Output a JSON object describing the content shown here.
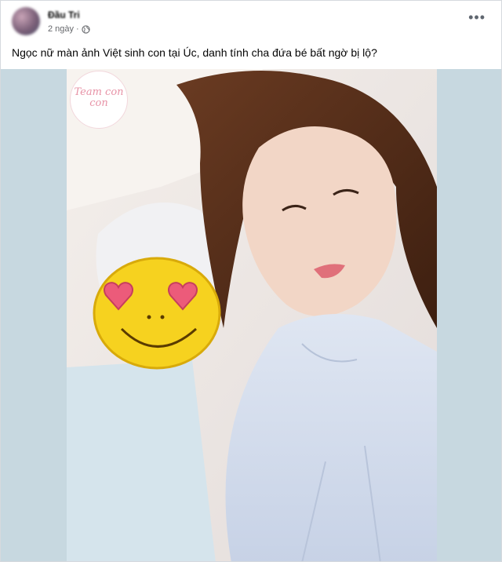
{
  "post": {
    "author": "Đầu Tri",
    "time": "2 ngày",
    "privacy_icon": "globe-icon",
    "more_label": "•••",
    "caption": "Ngọc nữ màn ảnh Việt sinh con tại Úc, danh tính cha đứa bé bất ngờ bị lộ?"
  },
  "photo": {
    "watermark": "Team con con",
    "overlay_emoji": "heart-eyes-smiley",
    "background_color": "#c7d8e0"
  }
}
